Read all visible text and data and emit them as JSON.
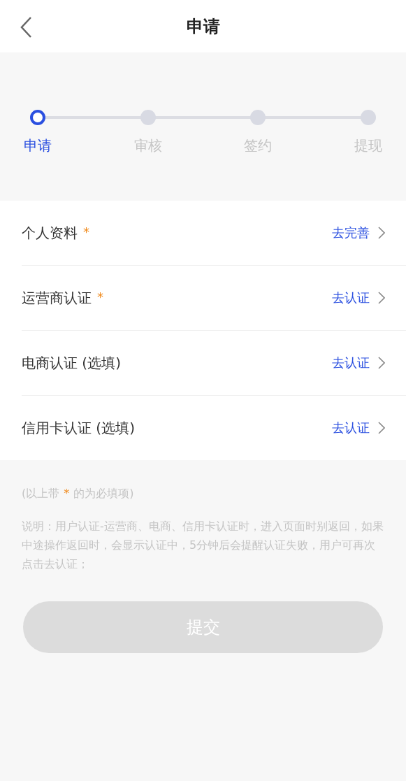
{
  "header": {
    "title": "申请"
  },
  "steps": [
    {
      "label": "申请",
      "selected": true
    },
    {
      "label": "审核",
      "selected": false
    },
    {
      "label": "签约",
      "selected": false
    },
    {
      "label": "提现",
      "selected": false
    }
  ],
  "items": [
    {
      "label": "个人资料",
      "mark": "*",
      "action": "去完善"
    },
    {
      "label": "运营商认证",
      "mark": "*",
      "action": "去认证"
    },
    {
      "label": "电商认证 (选填)",
      "action": "去认证"
    },
    {
      "label": "信用卡认证 (选填)",
      "action": "去认证"
    }
  ],
  "hint": {
    "before": "(以上带",
    "mark": "*",
    "after": "的为必填项)"
  },
  "note": "说明：用户认证-运营商、电商、信用卡认证时，进入页面时别返回，如果中途操作返回时，会显示认证中，5分钟后会提醒认证失败，用户可再次点击去认证；",
  "submit": {
    "label": "提交",
    "disabled": true
  }
}
